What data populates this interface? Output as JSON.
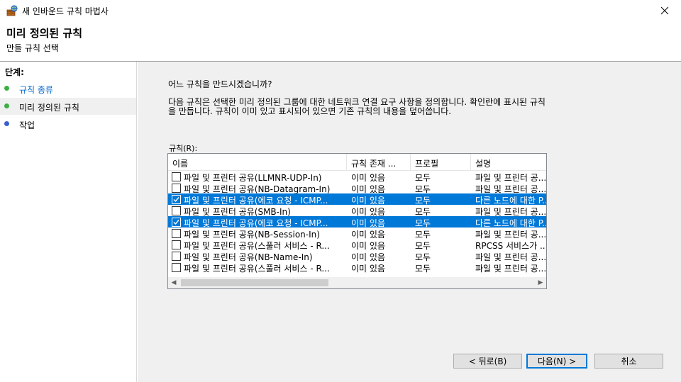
{
  "window": {
    "title": "새 인바운드 규칙 마법사",
    "close_symbol": "✕"
  },
  "header": {
    "title": "미리 정의된 규칙",
    "subtitle": "만들 규칙 선택"
  },
  "steps": {
    "title": "단계:",
    "items": [
      {
        "label": "규칙 종류",
        "dot_color": "#3cb043"
      },
      {
        "label": "미리 정의된 규칙",
        "dot_color": "#3cb043"
      },
      {
        "label": "작업",
        "dot_color": "#3a5fcd"
      }
    ]
  },
  "main": {
    "question": "어느 규칙을 만드시겠습니까?",
    "description": "다음 규칙은 선택한 미리 정의된 그룹에 대한 네트워크 연결 요구 사항을 정의합니다. 확인란에 표시된 규칙을 만듭니다. 규칙이 이미 있고 표시되어 있으면 기존 규칙의 내용을 덮어씁니다.",
    "rules_label": "규칙(R):",
    "columns": [
      "이름",
      "규칙 존재 ...",
      "프로필",
      "설명"
    ],
    "rows": [
      {
        "checked": false,
        "selected": false,
        "name": "파일 및 프린터 공유(LLMNR-UDP-In)",
        "exists": "이미 있음",
        "profile": "모두",
        "desc": "파일 및 프린터 공..."
      },
      {
        "checked": false,
        "selected": false,
        "name": "파일 및 프린터 공유(NB-Datagram-In)",
        "exists": "이미 있음",
        "profile": "모두",
        "desc": "파일 및 프린터 공..."
      },
      {
        "checked": true,
        "selected": true,
        "name": "파일 및 프린터 공유(에코 요청 - ICMP...",
        "exists": "이미 있음",
        "profile": "모두",
        "desc": "다른 노드에 대한 P..."
      },
      {
        "checked": false,
        "selected": false,
        "name": "파일 및 프린터 공유(SMB-In)",
        "exists": "이미 있음",
        "profile": "모두",
        "desc": "파일 및 프린터 공..."
      },
      {
        "checked": true,
        "selected": true,
        "name": "파일 및 프린터 공유(에코 요청 - ICMP...",
        "exists": "이미 있음",
        "profile": "모두",
        "desc": "다른 노드에 대한 P..."
      },
      {
        "checked": false,
        "selected": false,
        "name": "파일 및 프린터 공유(NB-Session-In)",
        "exists": "이미 있음",
        "profile": "모두",
        "desc": "파일 및 프린터 공..."
      },
      {
        "checked": false,
        "selected": false,
        "name": "파일 및 프린터 공유(스풀러 서비스 - R...",
        "exists": "이미 있음",
        "profile": "모두",
        "desc": "RPCSS 서비스가 ..."
      },
      {
        "checked": false,
        "selected": false,
        "name": "파일 및 프린터 공유(NB-Name-In)",
        "exists": "이미 있음",
        "profile": "모두",
        "desc": "파일 및 프린터 공..."
      },
      {
        "checked": false,
        "selected": false,
        "name": "파일 및 프린터 공유(스풀러 서비스 - R...",
        "exists": "이미 있음",
        "profile": "모두",
        "desc": "파일 및 프린터 공..."
      }
    ],
    "scroll_left": "◀",
    "scroll_right": "▶"
  },
  "buttons": {
    "back": "< 뒤로(B)",
    "next": "다음(N) >",
    "cancel": "취소"
  },
  "colors": {
    "selection": "#0078d7",
    "link": "#0066cc"
  }
}
